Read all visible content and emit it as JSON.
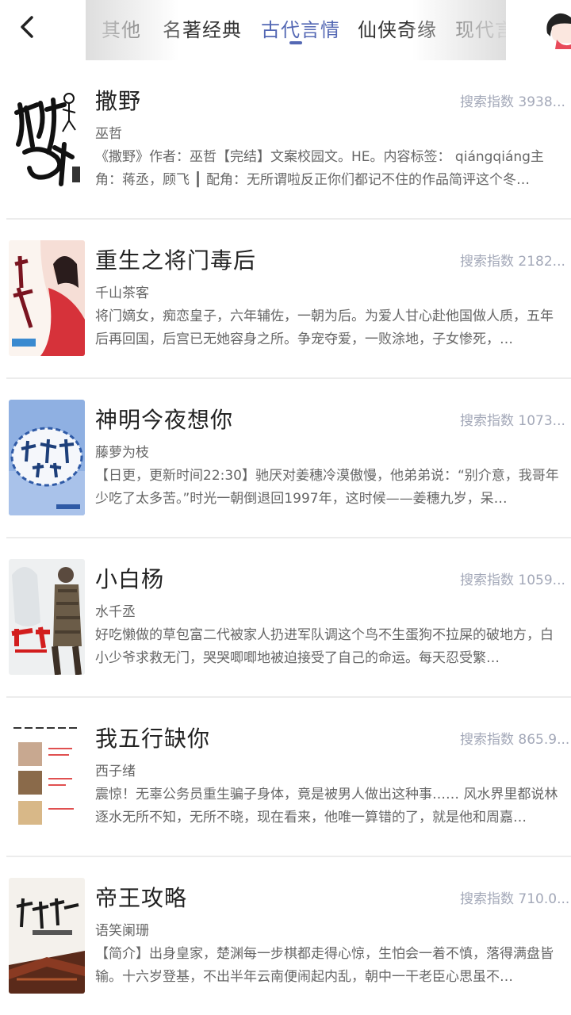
{
  "header": {
    "tabs": [
      {
        "label": "其他"
      },
      {
        "label": "名著经典"
      },
      {
        "label": "古代言情"
      },
      {
        "label": "仙侠奇缘"
      },
      {
        "label": "现代言"
      }
    ],
    "active_tab": "古代言情",
    "accent_color": "#5468b4"
  },
  "books": [
    {
      "title": "撒野",
      "author": "巫哲",
      "search_index": "搜索指数 3938...",
      "desc": "《撒野》作者：巫哲【完结】文案校园文。HE。内容标签： qiángqiáng主角：蒋丞，顾飞 ┃ 配角：无所谓啦反正你们都记不住的作品简评这个冬…"
    },
    {
      "title": "重生之将门毒后",
      "author": "千山茶客",
      "search_index": "搜索指数 2182...",
      "desc": "将门嫡女，痴恋皇子，六年辅佐，一朝为后。为爱人甘心赴他国做人质，五年后再回国，后宫已无她容身之所。争宠夺爱，一败涂地，子女惨死，…"
    },
    {
      "title": "神明今夜想你",
      "author": "藤萝为枝",
      "search_index": "搜索指数 1073...",
      "desc": "【日更，更新时间22:30】驰厌对姜穗冷漠傲慢，他弟弟说：“别介意，我哥年少吃了太多苦。”时光一朝倒退回1997年，这时候——姜穗九岁，呆…"
    },
    {
      "title": "小白杨",
      "author": "水千丞",
      "search_index": "搜索指数 1059...",
      "desc": "好吃懒做的草包富二代被家人扔进军队调这个鸟不生蛋狗不拉屎的破地方，白小少爷求救无门，哭哭唧唧地被迫接受了自己的命运。每天忍受繁…"
    },
    {
      "title": "我五行缺你",
      "author": "西子绪",
      "search_index": "搜索指数 865.9...",
      "desc": "震惊！无辜公务员重生骗子身体，竟是被男人做出这种事…… 风水界里都说林逐水无所不知，无所不晓，现在看来，他唯一算错的了，就是他和周嘉…"
    },
    {
      "title": "帝王攻略",
      "author": "语笑阑珊",
      "search_index": "搜索指数 710.0...",
      "desc": "【简介】出身皇家，楚渊每一步棋都走得心惊，生怕会一着不慎，落得满盘皆输。十六岁登基，不出半年云南便闹起内乱，朝中一干老臣心思虽不…"
    }
  ]
}
